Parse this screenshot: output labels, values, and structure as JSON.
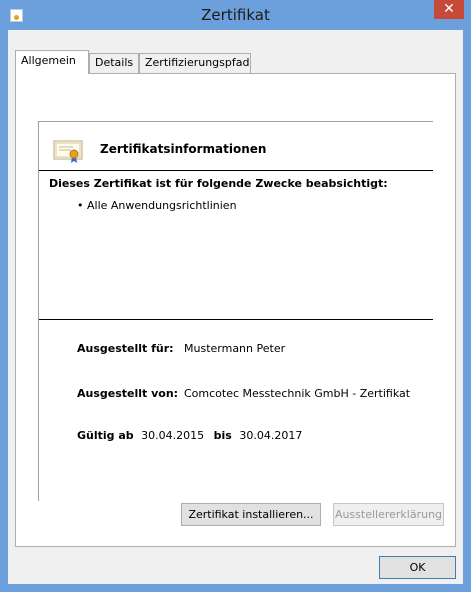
{
  "window": {
    "title": "Zertifikat",
    "close_label": "✕"
  },
  "tabs": [
    {
      "label": "Allgemein"
    },
    {
      "label": "Details"
    },
    {
      "label": "Zertifizierungspfad"
    }
  ],
  "info": {
    "heading": "Zertifikatsinformationen",
    "purpose_title": "Dieses Zertifikat ist für folgende Zwecke beabsichtigt:",
    "purposes": [
      "• Alle Anwendungsrichtlinien"
    ],
    "issued_to_label": "Ausgestellt für:",
    "issued_to_value": "Mustermann Peter",
    "issued_by_label": "Ausgestellt von:",
    "issued_by_value": "Comcotec Messtechnik GmbH - Zertifikat",
    "valid_from_label": "Gültig ab",
    "valid_from_value": "30.04.2015",
    "valid_to_label": "bis",
    "valid_to_value": "30.04.2017"
  },
  "buttons": {
    "install": "Zertifikat installieren...",
    "issuer_statement": "Ausstellererklärung",
    "ok": "OK"
  },
  "colors": {
    "frame": "#6ca0dc",
    "close": "#c7493a",
    "seal": "#e2a12a"
  }
}
